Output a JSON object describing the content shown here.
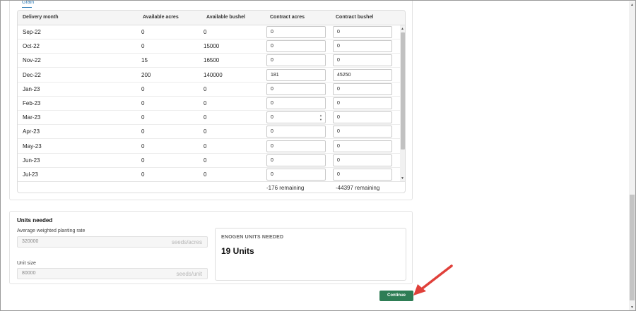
{
  "tab": {
    "label": "Grain"
  },
  "table": {
    "headers": {
      "delivery_month": "Delivery month",
      "available_acres": "Available acres",
      "available_bushel": "Available bushel",
      "contract_acres": "Contract acres",
      "contract_bushel": "Contract bushel"
    },
    "rows": [
      {
        "month": "Sep-22",
        "available_acres": "0",
        "available_bushel": "0",
        "contract_acres": "0",
        "contract_bushel": "0"
      },
      {
        "month": "Oct-22",
        "available_acres": "0",
        "available_bushel": "15000",
        "contract_acres": "0",
        "contract_bushel": "0"
      },
      {
        "month": "Nov-22",
        "available_acres": "15",
        "available_bushel": "16500",
        "contract_acres": "0",
        "contract_bushel": "0"
      },
      {
        "month": "Dec-22",
        "available_acres": "200",
        "available_bushel": "140000",
        "contract_acres": "181",
        "contract_bushel": "45250"
      },
      {
        "month": "Jan-23",
        "available_acres": "0",
        "available_bushel": "0",
        "contract_acres": "0",
        "contract_bushel": "0"
      },
      {
        "month": "Feb-23",
        "available_acres": "0",
        "available_bushel": "0",
        "contract_acres": "0",
        "contract_bushel": "0"
      },
      {
        "month": "Mar-23",
        "available_acres": "0",
        "available_bushel": "0",
        "contract_acres": "0",
        "contract_bushel": "0"
      },
      {
        "month": "Apr-23",
        "available_acres": "0",
        "available_bushel": "0",
        "contract_acres": "0",
        "contract_bushel": "0"
      },
      {
        "month": "May-23",
        "available_acres": "0",
        "available_bushel": "0",
        "contract_acres": "0",
        "contract_bushel": "0"
      },
      {
        "month": "Jun-23",
        "available_acres": "0",
        "available_bushel": "0",
        "contract_acres": "0",
        "contract_bushel": "0"
      },
      {
        "month": "Jul-23",
        "available_acres": "0",
        "available_bushel": "0",
        "contract_acres": "0",
        "contract_bushel": "0"
      }
    ],
    "footer": {
      "acres_remaining": "-176 remaining",
      "bushel_remaining": "-44397 remaining"
    }
  },
  "units": {
    "title": "Units needed",
    "planting_rate": {
      "label": "Average weighted planting rate",
      "value": "320000",
      "unit": "seeds/acres"
    },
    "unit_size": {
      "label": "Unit size",
      "value": "80000",
      "unit": "seeds/unit"
    },
    "enogen": {
      "label": "ENOGEN UNITS NEEDED",
      "value": "19 Units"
    }
  },
  "actions": {
    "continue_label": "Continue"
  },
  "colors": {
    "accent_green": "#2e7d55",
    "annotation_red": "#e0403a",
    "tab_blue": "#2e7bb5"
  },
  "icons": {
    "spinner": "spinner-icon",
    "arrow": "annotation-arrow-icon"
  }
}
